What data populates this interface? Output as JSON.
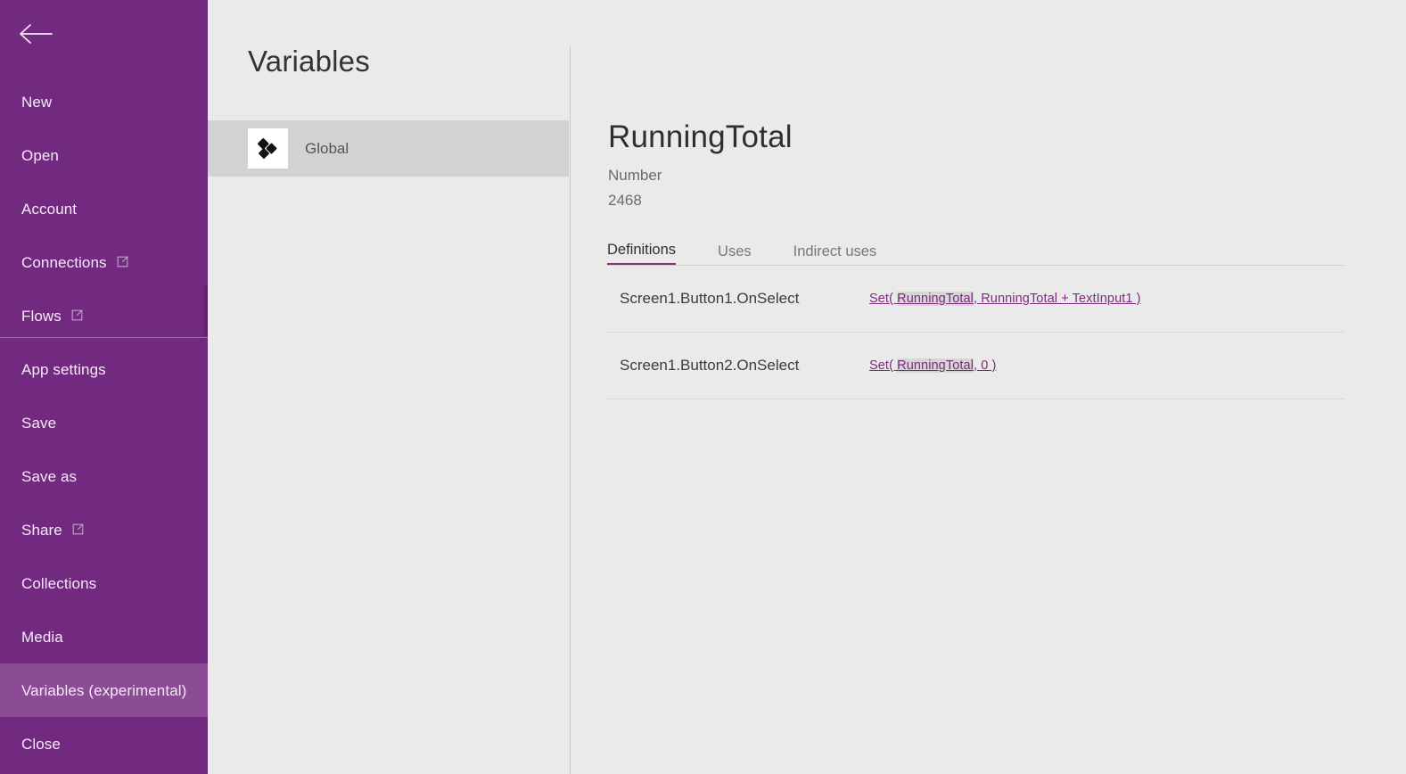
{
  "sidebar": {
    "back_icon": "back-arrow-icon",
    "items": [
      {
        "label": "New",
        "external": false,
        "selected": false
      },
      {
        "label": "Open",
        "external": false,
        "selected": false
      },
      {
        "label": "Account",
        "external": false,
        "selected": false
      },
      {
        "label": "Connections",
        "external": true,
        "selected": false
      },
      {
        "label": "Flows",
        "external": true,
        "selected": false
      },
      {
        "label": "App settings",
        "external": false,
        "selected": false
      },
      {
        "label": "Save",
        "external": false,
        "selected": false
      },
      {
        "label": "Save as",
        "external": false,
        "selected": false
      },
      {
        "label": "Share",
        "external": true,
        "selected": false
      },
      {
        "label": "Collections",
        "external": false,
        "selected": false
      },
      {
        "label": "Media",
        "external": false,
        "selected": false
      },
      {
        "label": "Variables (experimental)",
        "external": false,
        "selected": true
      },
      {
        "label": "Close",
        "external": false,
        "selected": false
      }
    ],
    "accent_color": "#722a80",
    "selected_color": "#8b4b95"
  },
  "list_pane": {
    "title": "Variables",
    "items": [
      {
        "label": "Global",
        "icon": "diamonds-icon",
        "selected": true
      }
    ]
  },
  "detail": {
    "name": "RunningTotal",
    "type": "Number",
    "value": "2468",
    "tabs": [
      {
        "label": "Definitions",
        "active": true
      },
      {
        "label": "Uses",
        "active": false
      },
      {
        "label": "Indirect uses",
        "active": false
      }
    ],
    "definitions": [
      {
        "target": "Screen1.Button1.OnSelect",
        "formula_prefix": "Set( ",
        "formula_highlight": "RunningTotal",
        "formula_suffix": ", RunningTotal + TextInput1 )"
      },
      {
        "target": "Screen1.Button2.OnSelect",
        "formula_prefix": "Set( ",
        "formula_highlight": "RunningTotal",
        "formula_suffix": ", 0 )"
      }
    ],
    "link_color": "#7b2d7b",
    "highlight_color": "#d6d6d6"
  }
}
